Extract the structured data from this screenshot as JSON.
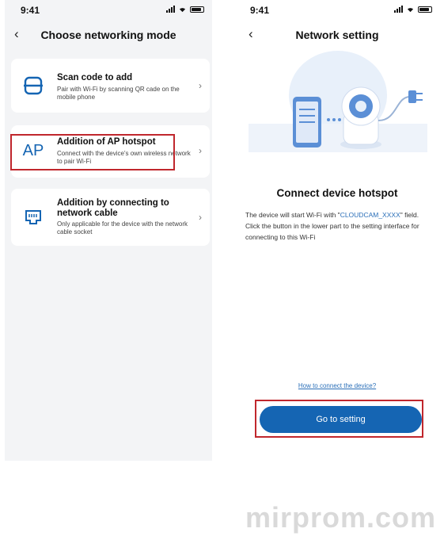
{
  "left_screen": {
    "status_time": "9:41",
    "title": "Choose networking mode",
    "options": [
      {
        "title": "Scan code to add",
        "desc": "Pair with Wi-Fi by scanning QR cade on the mobile phone",
        "icon": "scan-code-icon"
      },
      {
        "title": "Addition of AP hotspot",
        "desc": "Connect with the device's own wireless network to pair Wi-Fi",
        "icon": "ap-icon",
        "icon_text": "AP",
        "highlighted": true
      },
      {
        "title": "Addition by connecting to network cable",
        "desc": "Only applicable for the device with the network cable socket",
        "icon": "ethernet-port-icon"
      }
    ]
  },
  "right_screen": {
    "status_time": "9:41",
    "title": "Network setting",
    "heading": "Connect device hotspot",
    "desc_prefix": "The device will start Wi-Fi with \"",
    "ssid": "CLOUDCAM_XXXX",
    "desc_suffix": "\" field. Click the button in the lower part to the setting interface for connecting to this Wi-Fi",
    "help_link": "How to connect the device?",
    "button_label": "Go to setting",
    "illustration": [
      "phone-icon",
      "camera-icon",
      "wifi-plug-icon"
    ]
  },
  "watermark": "mirprom.com",
  "colors": {
    "accent": "#1565b3",
    "highlight": "#c0272d",
    "link": "#2b6fb8"
  }
}
